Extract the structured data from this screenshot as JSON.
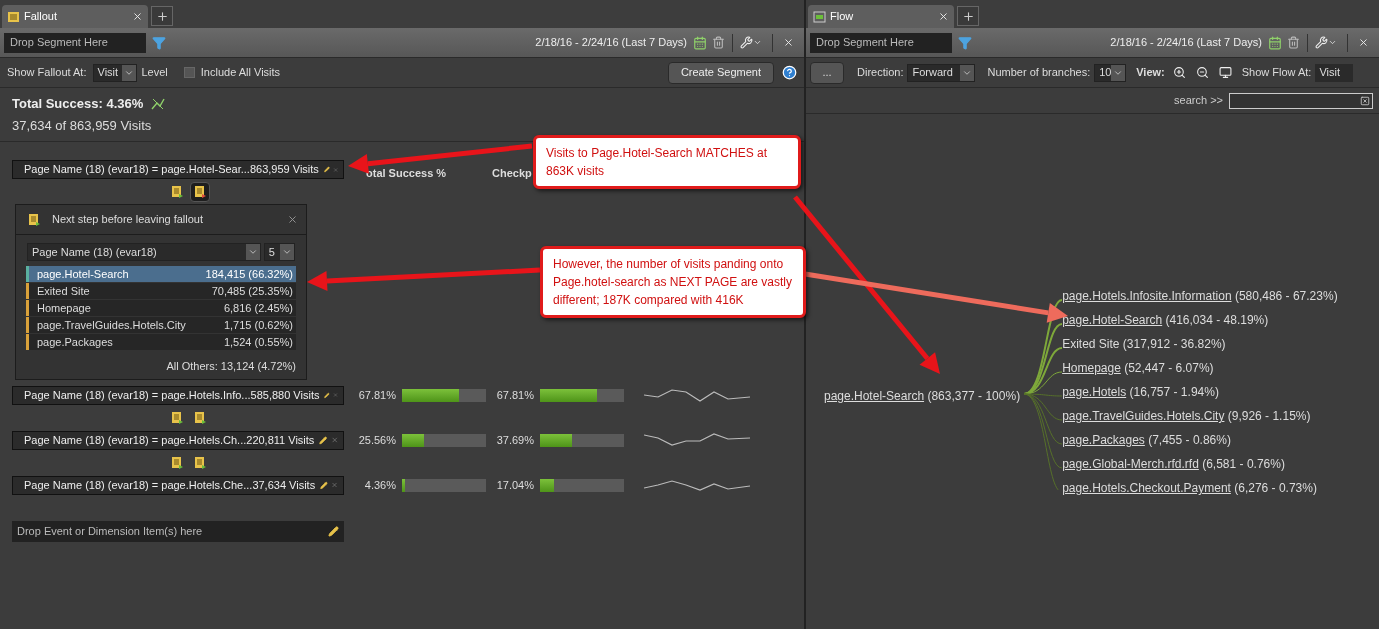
{
  "fallout": {
    "tab": {
      "title": "Fallout",
      "selected": true
    },
    "toolbar": {
      "segment_placeholder": "Drop Segment Here",
      "date_range": "2/18/16 - 2/24/16 (Last 7 Days)"
    },
    "options": {
      "show_at_label": "Show Fallout At:",
      "show_at_value": "Visit",
      "level_label": "Level",
      "include_all": {
        "label": "Include All Visits",
        "checked": false
      },
      "create_button": "Create Segment"
    },
    "summary": {
      "title": "Total Success: 4.36%",
      "subtitle": "37,634 of 863,959 Visits"
    },
    "column_headers": [
      "otal Success %",
      "Checkp"
    ],
    "steps": [
      {
        "label": "Page Name (18) (evar18) = page.Hotel-Sear...",
        "visits": "863,959 Visits",
        "breakdown_open": true
      },
      {
        "label": "Page Name (18) (evar18) = page.Hotels.Info...",
        "visits": "585,880 Visits",
        "total": {
          "text": "67.81%",
          "level": 0.68
        },
        "checkpoint": {
          "text": "67.81%",
          "level": 0.68
        },
        "breakdown_open": false
      },
      {
        "label": "Page Name (18) (evar18) = page.Hotels.Ch...",
        "visits": "220,811 Visits",
        "total": {
          "text": "25.56%",
          "level": 0.26
        },
        "checkpoint": {
          "text": "37.69%",
          "level": 0.38
        },
        "breakdown_open": false
      },
      {
        "label": "Page Name (18) (evar18) = page.Hotels.Che...",
        "visits": "37,634 Visits",
        "total": {
          "text": "4.36%",
          "level": 0.03
        },
        "checkpoint": {
          "text": "17.04%",
          "level": 0.17
        }
      }
    ],
    "breakdown": {
      "title": "Next step before leaving fallout",
      "dimension": "Page Name (18) (evar18)",
      "count": "5",
      "items": [
        {
          "name": "page.Hotel-Search",
          "value": "184,415 (66.32%)",
          "selected": true
        },
        {
          "name": "Exited Site",
          "value": "70,485 (25.35%)",
          "selected": false
        },
        {
          "name": "Homepage",
          "value": "6,816 (2.45%)",
          "selected": false
        },
        {
          "name": "page.TravelGuides.Hotels.City",
          "value": "1,715 (0.62%)",
          "selected": false
        },
        {
          "name": "page.Packages",
          "value": "1,524 (0.55%)",
          "selected": false
        }
      ],
      "footer": "All Others: 13,124 (4.72%)"
    },
    "drop_placeholder": "Drop Event or Dimension Item(s) here"
  },
  "flow": {
    "tab": {
      "title": "Flow",
      "selected": true
    },
    "toolbar": {
      "segment_placeholder": "Drop Segment Here",
      "date_range": "2/18/16 - 2/24/16 (Last 7 Days)"
    },
    "options": {
      "more_button": "...",
      "direction_label": "Direction:",
      "direction_value": "Forward",
      "branches_label": "Number of branches:",
      "branches_value": "10",
      "view_label": "View:",
      "show_at_label": "Show Flow At:",
      "show_at_value": "Visit"
    },
    "search_label": "search >>",
    "source": {
      "name": "page.Hotel-Search",
      "value": "(863,377 - 100%)"
    },
    "targets": [
      {
        "name": "page.Hotels.Infosite.Information",
        "value": "(580,486 - 67.23%)",
        "link": true
      },
      {
        "name": "page.Hotel-Search",
        "value": "(416,034 - 48.19%)",
        "link": true
      },
      {
        "name": "Exited Site",
        "value": "(317,912 - 36.82%)",
        "link": false
      },
      {
        "name": "Homepage",
        "value": "(52,447 - 6.07%)",
        "link": true
      },
      {
        "name": "page.Hotels",
        "value": "(16,757 - 1.94%)",
        "link": true
      },
      {
        "name": "page.TravelGuides.Hotels.City",
        "value": "(9,926 - 1.15%)",
        "link": true
      },
      {
        "name": "page.Packages",
        "value": "(7,455 - 0.86%)",
        "link": true
      },
      {
        "name": "page.Global-Merch.rfd.rfd",
        "value": "(6,581 - 0.76%)",
        "link": true
      },
      {
        "name": "page.Hotels.Checkout.Payment",
        "value": "(6,276 - 0.73%)",
        "link": true
      }
    ]
  },
  "annotations": [
    {
      "text": "Visits to Page.Hotel-Search MATCHES at 863K visits"
    },
    {
      "text": "However, the number of visits panding onto Page.hotel-search as NEXT PAGE are vastly different; 187K compared with 416K"
    }
  ]
}
